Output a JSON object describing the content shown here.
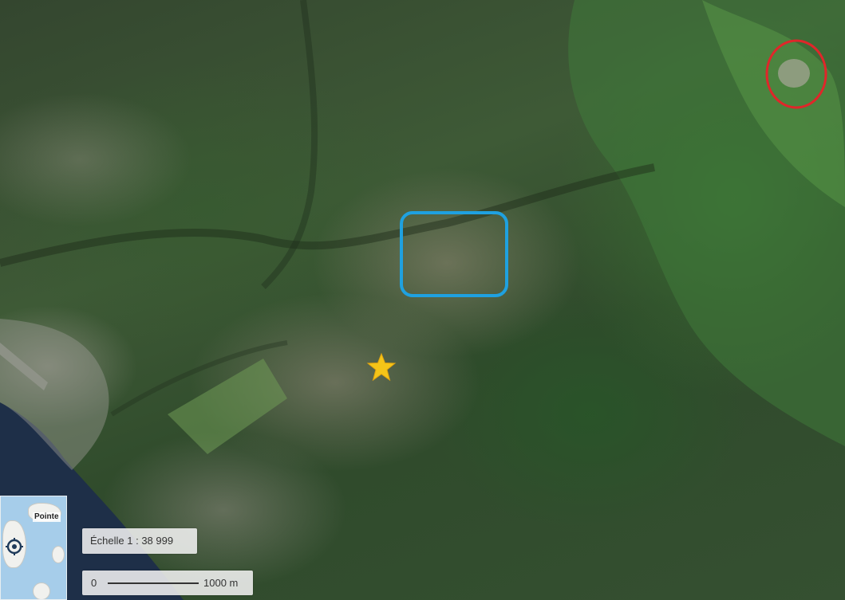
{
  "map": {
    "layer": "satellite imagery",
    "markers": [
      {
        "name": "volcano-summit-highlight",
        "shape": "ellipse",
        "color": "#e0262a"
      },
      {
        "name": "town-area-highlight",
        "shape": "rounded-rectangle",
        "color": "#1fa1e0"
      },
      {
        "name": "location-star",
        "shape": "star",
        "color": "#f5c518"
      }
    ]
  },
  "minimap": {
    "label": "Pointe",
    "colors": {
      "sea": "#a6cdea",
      "land": "#f1f1ee"
    },
    "icon": "location-target-icon"
  },
  "scale": {
    "ratio_text": "Échelle 1 :  38 999",
    "bar_start": "0",
    "bar_end": "1000 m"
  }
}
